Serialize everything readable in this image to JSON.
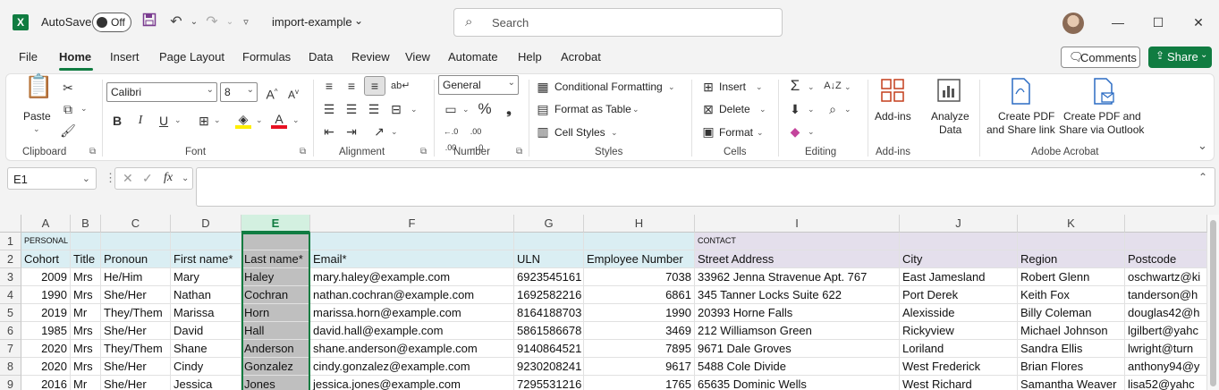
{
  "titlebar": {
    "autosave_label": "AutoSave",
    "autosave_state": "Off",
    "filename": "import-example",
    "search_placeholder": "Search"
  },
  "tabs": [
    "File",
    "Home",
    "Insert",
    "Page Layout",
    "Formulas",
    "Data",
    "Review",
    "View",
    "Automate",
    "Help",
    "Acrobat"
  ],
  "active_tab": "Home",
  "actions": {
    "comments": "Comments",
    "share": "Share"
  },
  "ribbon": {
    "clipboard": {
      "paste": "Paste",
      "label": "Clipboard"
    },
    "font": {
      "name": "Calibri",
      "size": "8",
      "label": "Font",
      "bold": "B",
      "italic": "I",
      "underline": "U"
    },
    "alignment": {
      "label": "Alignment"
    },
    "number": {
      "format": "General",
      "label": "Number"
    },
    "styles": {
      "conditional": "Conditional Formatting",
      "table": "Format as Table",
      "cell_styles": "Cell Styles",
      "label": "Styles"
    },
    "cells": {
      "insert": "Insert",
      "delete": "Delete",
      "format": "Format",
      "label": "Cells"
    },
    "editing": {
      "label": "Editing"
    },
    "addins": {
      "addins": "Add-ins",
      "analyze1": "Analyze",
      "analyze2": "Data",
      "label": "Add-ins"
    },
    "acrobat": {
      "c1a": "Create PDF",
      "c1b": "and Share link",
      "c2a": "Create PDF and",
      "c2b": "Share via Outlook",
      "label": "Adobe Acrobat"
    }
  },
  "formula_bar": {
    "name_box": "E1",
    "fx": "fx",
    "formula": ""
  },
  "columns": [
    "A",
    "B",
    "C",
    "D",
    "E",
    "F",
    "G",
    "H",
    "I",
    "J",
    "K"
  ],
  "selected_column": "E",
  "row_numbers": [
    "1",
    "2",
    "3",
    "4",
    "5",
    "6",
    "7",
    "8",
    "9"
  ],
  "sheet": {
    "row1": {
      "A": "PERSONAL",
      "I": "CONTACT"
    },
    "headers": [
      "Cohort",
      "Title",
      "Pronoun",
      "First name*",
      "Last name*",
      "Email*",
      "ULN",
      "Employee Number",
      "Street Address",
      "City",
      "Region",
      "Postcode"
    ],
    "rows": [
      [
        "2009",
        "Mrs",
        "He/Him",
        "Mary",
        "Haley",
        "mary.haley@example.com",
        "6923545161",
        "7038",
        "33962 Jenna Stravenue Apt. 767",
        "East Jamesland",
        "Robert Glenn",
        "oschwartz@ki"
      ],
      [
        "1990",
        "Mrs",
        "She/Her",
        "Nathan",
        "Cochran",
        "nathan.cochran@example.com",
        "1692582216",
        "6861",
        "345 Tanner Locks Suite 622",
        "Port Derek",
        "Keith Fox",
        "tanderson@h"
      ],
      [
        "2019",
        "Mr",
        "They/Them",
        "Marissa",
        "Horn",
        "marissa.horn@example.com",
        "8164188703",
        "1990",
        "20393 Horne Falls",
        "Alexisside",
        "Billy Coleman",
        "douglas42@h"
      ],
      [
        "1985",
        "Mrs",
        "She/Her",
        "David",
        "Hall",
        "david.hall@example.com",
        "5861586678",
        "3469",
        "212 Williamson Green",
        "Rickyview",
        "Michael Johnson",
        "lgilbert@yahc"
      ],
      [
        "2020",
        "Mrs",
        "They/Them",
        "Shane",
        "Anderson",
        "shane.anderson@example.com",
        "9140864521",
        "7895",
        "9671 Dale Groves",
        "Loriland",
        "Sandra Ellis",
        "lwright@turn"
      ],
      [
        "2020",
        "Mrs",
        "She/Her",
        "Cindy",
        "Gonzalez",
        "cindy.gonzalez@example.com",
        "9230208241",
        "9617",
        "5488 Cole Divide",
        "West Frederick",
        "Brian Flores",
        "anthony94@y"
      ],
      [
        "2016",
        "Mr",
        "She/Her",
        "Jessica",
        "Jones",
        "jessica.jones@example.com",
        "7295531216",
        "1765",
        "65635 Dominic Wells",
        "West Richard",
        "Samantha Weaver",
        "lisa52@yahc"
      ]
    ]
  },
  "colors": {
    "accent": "#107c41",
    "personal_band": "#daeef3",
    "contact_band": "#e4dfec",
    "selected_col": "#bfbfbf"
  }
}
